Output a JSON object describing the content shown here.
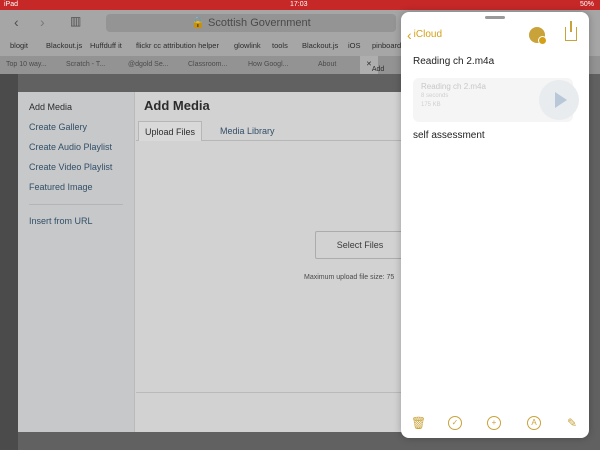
{
  "status_bar": {
    "device": "iPad",
    "time": "17:03",
    "battery": "50%"
  },
  "safari": {
    "url": "Scottish Government",
    "bookmarks": [
      "blogit",
      "Blackout.js",
      "Huffduff it",
      "flickr cc attribution helper",
      "glowlink",
      "tools",
      "Blackout.js",
      "iOS",
      "pinboard"
    ],
    "tabs": [
      "Top 10 way...",
      "Scratch - T...",
      "@dgold Se...",
      "Classroom...",
      "How Googl...",
      "About",
      "Add New"
    ]
  },
  "media_modal": {
    "menu": [
      "Add Media",
      "Create Gallery",
      "Create Audio Playlist",
      "Create Video Playlist",
      "Featured Image",
      "Insert from URL"
    ],
    "title": "Add Media",
    "tabs": [
      "Upload Files",
      "Media Library"
    ],
    "select_button": "Select Files",
    "max_upload": "Maximum upload file size: 75"
  },
  "notes": {
    "back_label": "iCloud",
    "note_title": "Reading ch 2.m4a",
    "attachment": {
      "name": "Reading ch 2.m4a",
      "meta1": "8 seconds",
      "meta2": "175 KB"
    },
    "body": "self assessment",
    "accent_color": "#d4a017",
    "toolbar_icons": [
      "trash-icon",
      "checklist-icon",
      "add-icon",
      "markup-icon",
      "compose-icon"
    ]
  }
}
